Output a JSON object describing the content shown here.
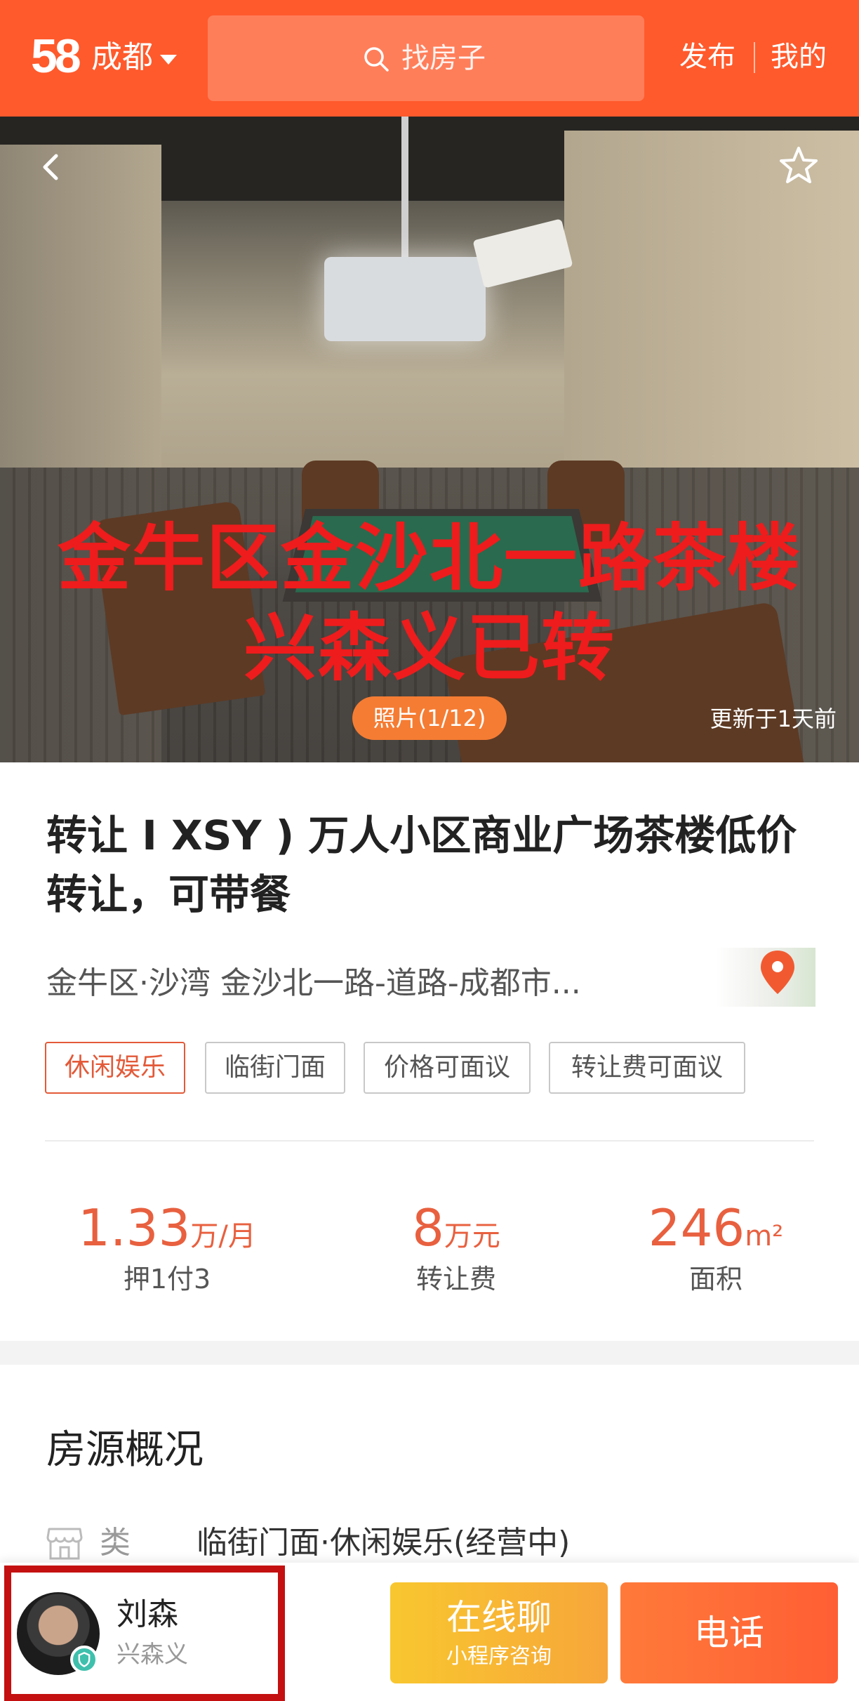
{
  "header": {
    "logo": "58",
    "city": "成都",
    "search_placeholder": "找房子",
    "publish": "发布",
    "mine": "我的",
    "brand_color": "#ff5a2c"
  },
  "photo": {
    "overlay_line1": "金牛区金沙北一路茶楼",
    "overlay_line2": "兴森义已转",
    "count": "照片(1/12)",
    "updated": "更新于1天前",
    "back_icon": "chevron-left-icon",
    "favorite_icon": "star-outline-icon"
  },
  "listing": {
    "title": "转让 I XSY ) 万人小区商业广场茶楼低价转让，可带餐",
    "address": "金牛区·沙湾 金沙北一路-道路-成都市...",
    "tags": [
      "休闲娱乐",
      "临街门面",
      "价格可面议",
      "转让费可面议"
    ],
    "active_tag_color": "#e35a39"
  },
  "stats": {
    "rent": {
      "value": "1.33",
      "unit": "万/月",
      "label": "押1付3"
    },
    "transfer": {
      "value": "8",
      "unit": "万元",
      "label": "转让费"
    },
    "area": {
      "value": "246",
      "unit": "m²",
      "label": "面积"
    },
    "accent_color": "#e8603f"
  },
  "overview": {
    "title": "房源概况",
    "type_label": "类型",
    "type_value": "临街门面·休闲娱乐(经营中)"
  },
  "agent": {
    "name": "刘森",
    "company": "兴森义"
  },
  "actions": {
    "chat": "在线聊",
    "chat_sub": "小程序咨询",
    "phone": "电话"
  }
}
